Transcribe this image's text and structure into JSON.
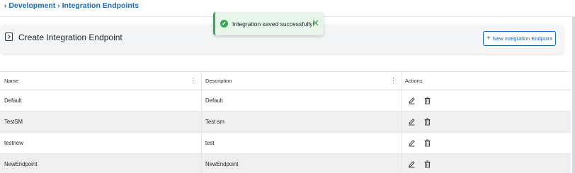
{
  "breadcrumb": {
    "items": [
      "Development",
      "Integration Endpoints"
    ],
    "separator": "›"
  },
  "toast": {
    "message": "Integration saved successfully!",
    "icon": "check-circle-icon",
    "close_icon": "close-icon",
    "color": "#3aa757"
  },
  "header": {
    "title": "Create Integration Endpoint",
    "icon": "panel-collapse-icon",
    "new_button_label": "New Integration Endpoint",
    "new_button_icon": "plus-icon"
  },
  "table": {
    "columns": [
      "Name",
      "Description",
      "Actions"
    ],
    "rows": [
      {
        "name": "Default",
        "description": "Default"
      },
      {
        "name": "TestSM",
        "description": "Test sm"
      },
      {
        "name": "testnew",
        "description": "test"
      },
      {
        "name": "NewEndpoint",
        "description": "NewEndpoint"
      }
    ],
    "action_icons": [
      "edit-icon",
      "delete-icon"
    ]
  },
  "colors": {
    "accent": "#1a6bb5",
    "success": "#3aa757",
    "row_alt": "#efefef"
  }
}
